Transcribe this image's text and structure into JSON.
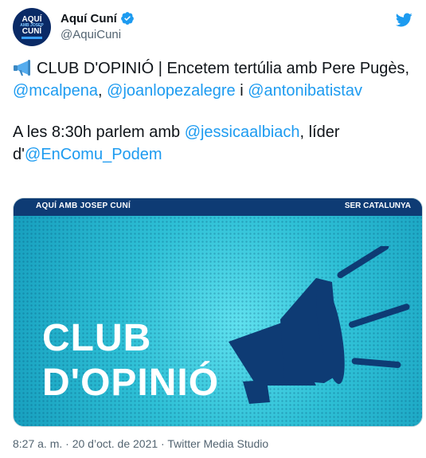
{
  "author": {
    "avatar": {
      "line1": "AQUÍ",
      "line2": "AMB JOSEP",
      "line3": "CUNÍ"
    },
    "display_name": "Aquí Cuní",
    "handle": "@AquiCuni"
  },
  "tweet": {
    "line1_text": "CLUB D'OPINIÓ | Encetem tertúlia amb Pere Pugès, ",
    "mention1": "@mcalpena",
    "sep1": ", ",
    "mention2": "@joanlopezalegre",
    "sep2": " i ",
    "mention3": "@antonibatistav",
    "line2_text": "A les 8:30h parlem amb ",
    "mention4": "@jessicaalbiach",
    "line2_mid": ", líder d'",
    "mention5": "@EnComu_Podem"
  },
  "media": {
    "bar_logo": "AQUÍ AMB JOSEP CUNÍ",
    "bar_ser": "SER CATALUNYA",
    "title_line1": "CLUB",
    "title_line2": "D'OPINIÓ"
  },
  "meta": {
    "time": "8:27 a. m.",
    "dot": " · ",
    "date": "20 d’oct. de 2021",
    "source": "Twitter Media Studio"
  },
  "colors": {
    "link": "#1d9bf0",
    "brand_navy": "#0e3b74",
    "image_cyan": "#2ec0d6"
  },
  "icons": [
    "verified-badge-icon",
    "twitter-logo-icon",
    "megaphone-emoji-icon"
  ]
}
